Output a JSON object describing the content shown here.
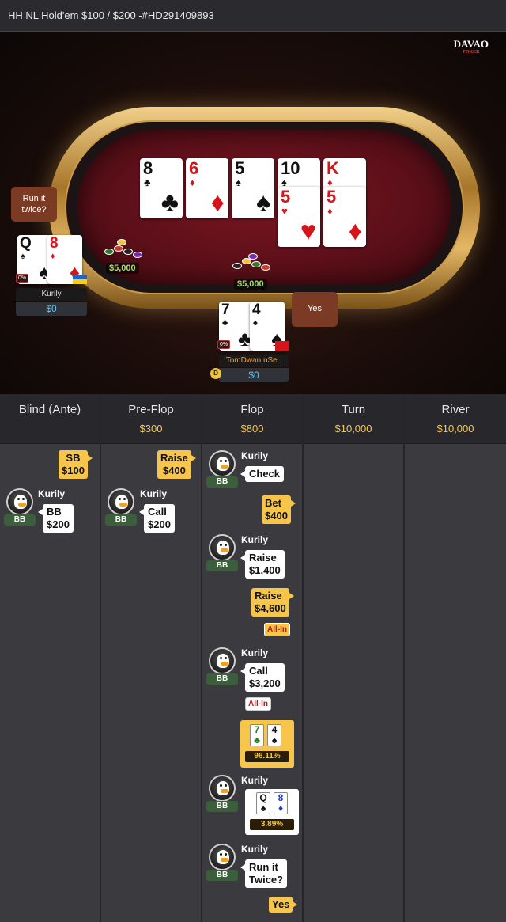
{
  "window": {
    "title": "HH NL Hold'em $100 / $200 -#HD291409893"
  },
  "logo": {
    "main": "DAVAO",
    "sub": "POKER"
  },
  "board": [
    {
      "rank": "8",
      "suit": "♣",
      "color": "black"
    },
    {
      "rank": "6",
      "suit": "♦",
      "color": "red"
    },
    {
      "rank": "5",
      "suit": "♠",
      "color": "black"
    },
    {
      "rank": "10",
      "suit": "♠",
      "color": "black"
    },
    {
      "rank": "K",
      "suit": "♦",
      "color": "red"
    },
    {
      "rank": "5",
      "suit": "♥",
      "color": "red"
    },
    {
      "rank": "5",
      "suit": "♦",
      "color": "red"
    }
  ],
  "bubbles": {
    "left": "Run it twice?",
    "right": "Yes"
  },
  "players": {
    "left": {
      "name": "Kurily",
      "stack": "$0",
      "equity": "0%",
      "bet": "$5,000",
      "cards": [
        {
          "rank": "Q",
          "suit": "♠"
        },
        {
          "rank": "8",
          "suit": "♦"
        }
      ]
    },
    "bottom": {
      "name": "TomDwanInSe..",
      "stack": "$0",
      "equity": "0%",
      "dealer": "D",
      "cards": [
        {
          "rank": "7",
          "suit": "♣"
        },
        {
          "rank": "4",
          "suit": "♠"
        }
      ]
    }
  },
  "pot": {
    "amount": "$5,000"
  },
  "columns": [
    {
      "title": "Blind (Ante)",
      "amount": ""
    },
    {
      "title": "Pre-Flop",
      "amount": "$300"
    },
    {
      "title": "Flop",
      "amount": "$800"
    },
    {
      "title": "Turn",
      "amount": "$10,000"
    },
    {
      "title": "River",
      "amount": "$10,000"
    }
  ],
  "history": {
    "blind": {
      "hero": "SB\n$100",
      "opp_name": "Kurily",
      "opp_pos": "BB",
      "opp": "BB\n$200"
    },
    "preflop": {
      "hero": "Raise\n$400",
      "opp_name": "Kurily",
      "opp_pos": "BB",
      "opp": "Call\n$200"
    },
    "flop": {
      "a1_name": "Kurily",
      "a1_pos": "BB",
      "a1": "Check",
      "h1": "Bet\n$400",
      "a2_name": "Kurily",
      "a2_pos": "BB",
      "a2": "Raise\n$1,400",
      "h2": "Raise\n$4,600",
      "h2_allin": "All-In",
      "a3_name": "Kurily",
      "a3_pos": "BB",
      "a3": "Call\n$3,200",
      "a3_allin": "All-In",
      "hero_show": {
        "cards": [
          {
            "rank": "7",
            "suit": "♣"
          },
          {
            "rank": "4",
            "suit": "♠"
          }
        ],
        "equity": "96.11%"
      },
      "a4_name": "Kurily",
      "a4_pos": "BB",
      "opp_show": {
        "cards": [
          {
            "rank": "Q",
            "suit": "♠"
          },
          {
            "rank": "8",
            "suit": "♦"
          }
        ],
        "equity": "3.89%"
      },
      "a5_name": "Kurily",
      "a5_pos": "BB",
      "a5": "Run it\nTwice?",
      "h3": "Yes"
    }
  },
  "colors": {
    "accent": "#f6c54a",
    "stack": "#6cc4f0",
    "felt": "#6a1420"
  }
}
